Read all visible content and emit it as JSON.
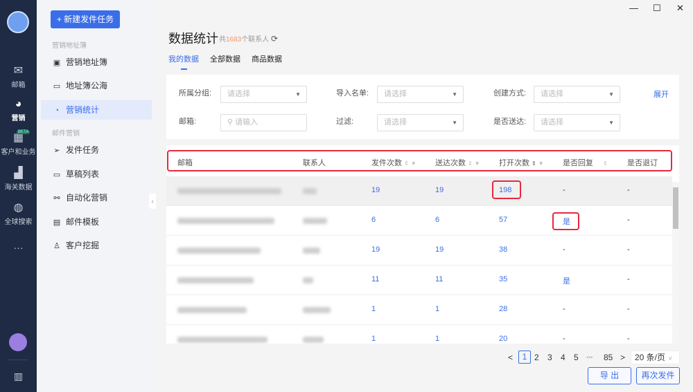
{
  "nav": {
    "items": [
      {
        "label": "邮箱",
        "icon": "mail-icon"
      },
      {
        "label": "营销",
        "icon": "pie-chart-icon"
      },
      {
        "label": "客户和业务",
        "icon": "customer-icon",
        "badge": "BETA"
      },
      {
        "label": "海关数据",
        "icon": "bar-chart-icon"
      },
      {
        "label": "全球搜索",
        "icon": "globe-icon"
      }
    ],
    "more": "···"
  },
  "sidebar": {
    "new_task": "+ 新建发件任务",
    "section1": "营销地址簿",
    "section2": "邮件营销",
    "items": [
      "营销地址簿",
      "地址簿公海",
      "营销统计",
      "发件任务",
      "草稿列表",
      "自动化营销",
      "邮件模板",
      "客户挖掘"
    ]
  },
  "window": {
    "minimize": "—",
    "maximize": "☐",
    "close": "✕"
  },
  "header": {
    "title": "数据统计",
    "count_prefix": "共",
    "count": "1683",
    "count_suffix": "个联系人"
  },
  "tabs": [
    "我的数据",
    "全部数据",
    "商品数据"
  ],
  "filters": {
    "group_label": "所属分组:",
    "import_label": "导入名单:",
    "create_label": "创建方式:",
    "email_label": "邮箱:",
    "filter_label": "过滤:",
    "delivered_label": "是否送达:",
    "select_placeholder": "请选择",
    "input_placeholder": "请输入",
    "expand": "展开"
  },
  "table": {
    "headers": [
      "邮箱",
      "联系人",
      "发件次数",
      "送达次数",
      "打开次数",
      "是否回复",
      "是否退订"
    ],
    "rows": [
      {
        "sends": "19",
        "delivered": "19",
        "opens": "198",
        "reply": "-",
        "unsub": "-"
      },
      {
        "sends": "6",
        "delivered": "6",
        "opens": "57",
        "reply": "是",
        "unsub": "-"
      },
      {
        "sends": "19",
        "delivered": "19",
        "opens": "38",
        "reply": "-",
        "unsub": "-"
      },
      {
        "sends": "11",
        "delivered": "11",
        "opens": "35",
        "reply": "是",
        "unsub": "-"
      },
      {
        "sends": "1",
        "delivered": "1",
        "opens": "28",
        "reply": "-",
        "unsub": "-"
      },
      {
        "sends": "1",
        "delivered": "1",
        "opens": "20",
        "reply": "-",
        "unsub": "-"
      }
    ]
  },
  "pagination": {
    "prev": "<",
    "pages": [
      "1",
      "2",
      "3",
      "4",
      "5"
    ],
    "ellipsis": "•••",
    "last": "85",
    "next": ">",
    "page_size": "20 条/页"
  },
  "actions": {
    "export": "导 出",
    "resend": "再次发件"
  }
}
